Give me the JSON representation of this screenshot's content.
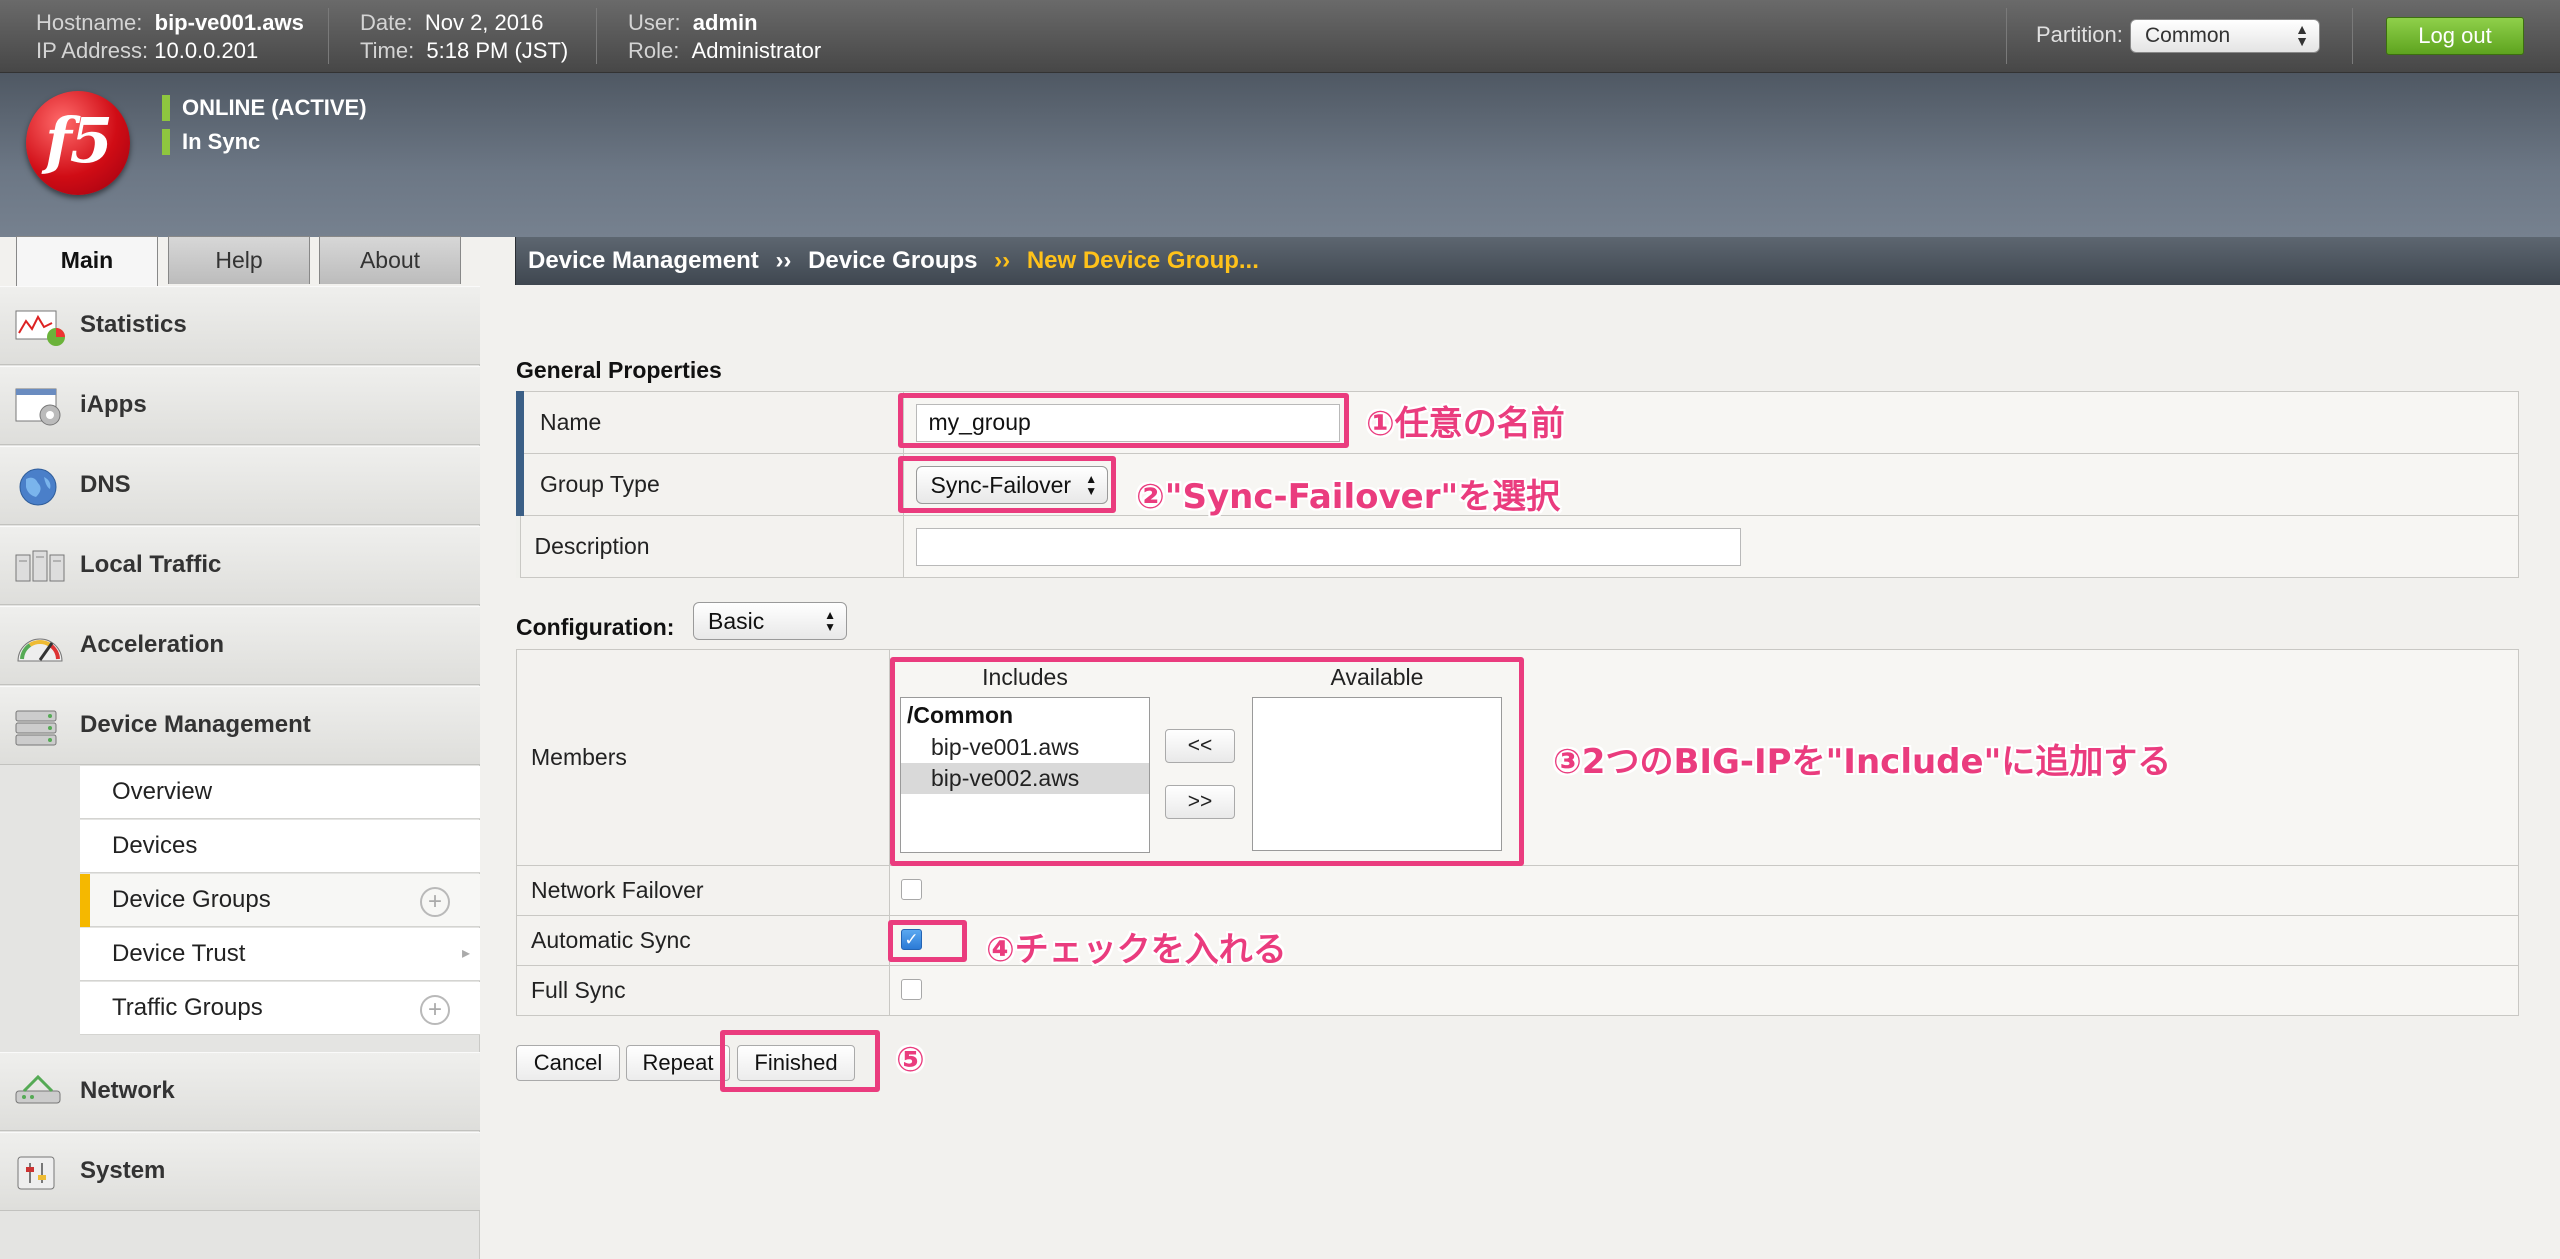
{
  "topbar": {
    "hostname_label": "Hostname:",
    "hostname": "bip-ve001.aws",
    "ip_label": "IP Address:",
    "ip": "10.0.0.201",
    "date_label": "Date:",
    "date": "Nov 2, 2016",
    "time_label": "Time:",
    "time": "5:18 PM (JST)",
    "user_label": "User:",
    "user": "admin",
    "role_label": "Role:",
    "role": "Administrator",
    "partition_label": "Partition:",
    "partition_value": "Common",
    "logout_label": "Log out"
  },
  "header": {
    "logo_text": "f5",
    "status_online": "ONLINE (ACTIVE)",
    "status_sync": "In Sync",
    "status_color": "#8ec63f"
  },
  "tabs": [
    {
      "label": "Main",
      "active": true
    },
    {
      "label": "Help",
      "active": false
    },
    {
      "label": "About",
      "active": false
    }
  ],
  "breadcrumb": {
    "items": [
      "Device Management",
      "Device Groups"
    ],
    "separator": "››",
    "current": "New Device Group..."
  },
  "sidebar": {
    "items": [
      {
        "label": "Statistics",
        "icon": "statistics-icon"
      },
      {
        "label": "iApps",
        "icon": "iapps-icon"
      },
      {
        "label": "DNS",
        "icon": "dns-globe-icon"
      },
      {
        "label": "Local Traffic",
        "icon": "local-traffic-icon"
      },
      {
        "label": "Acceleration",
        "icon": "acceleration-gauge-icon"
      },
      {
        "label": "Device Management",
        "icon": "device-management-icon"
      },
      {
        "label": "Network",
        "icon": "network-icon"
      },
      {
        "label": "System",
        "icon": "system-icon"
      }
    ],
    "subitems": [
      {
        "label": "Overview"
      },
      {
        "label": "Devices"
      },
      {
        "label": "Device Groups",
        "selected": true,
        "plus": "+"
      },
      {
        "label": "Device Trust",
        "arrow": "▸"
      },
      {
        "label": "Traffic Groups",
        "plus": "+"
      }
    ],
    "accent_color": "#f5b800"
  },
  "general": {
    "title": "General Properties",
    "name_label": "Name",
    "name_value": "my_group",
    "group_type_label": "Group Type",
    "group_type_value": "Sync-Failover",
    "description_label": "Description",
    "description_value": ""
  },
  "configuration": {
    "label": "Configuration:",
    "mode": "Basic",
    "members_label": "Members",
    "includes_header": "Includes",
    "available_header": "Available",
    "includes_group": "/Common",
    "includes": [
      "bip-ve001.aws",
      "bip-ve002.aws"
    ],
    "move_left": "<<",
    "move_right": ">>",
    "network_failover_label": "Network Failover",
    "network_failover": false,
    "automatic_sync_label": "Automatic Sync",
    "automatic_sync": true,
    "full_sync_label": "Full Sync",
    "full_sync": false,
    "check_mark": "✓"
  },
  "actions": {
    "cancel": "Cancel",
    "repeat": "Repeat",
    "finished": "Finished"
  },
  "annotations": {
    "a1": "①任意の名前",
    "a2": "②\"Sync-Failover\"を選択",
    "a3": "③2つのBIG-IPを\"Include\"に追加する",
    "a4": "④チェックを入れる",
    "a5": "⑤",
    "color": "#ea3c7e"
  }
}
